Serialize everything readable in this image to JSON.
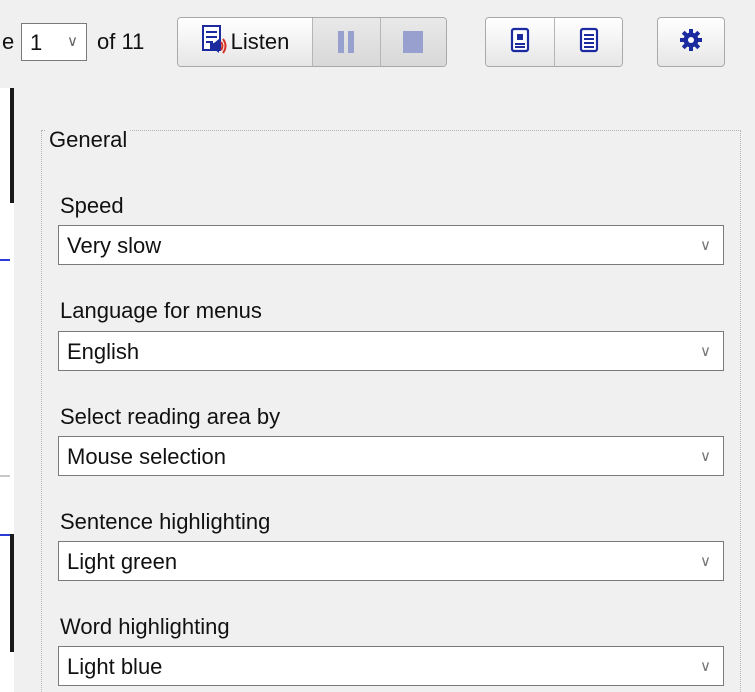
{
  "toolbar": {
    "page_prefix": "e",
    "page_value": "1",
    "page_of": "of 11",
    "listen_label": "Listen"
  },
  "icons": {
    "listen": "speaker-document-icon",
    "pause": "pause-icon",
    "stop": "stop-icon",
    "view1": "page-view-icon",
    "view2": "text-view-icon",
    "settings": "gear-icon",
    "chevron": "chevron-down-icon"
  },
  "chevron_glyph": "∨",
  "settings": {
    "group_label": "General",
    "fields": [
      {
        "label": "Speed",
        "value": "Very slow"
      },
      {
        "label": "Language for menus",
        "value": "English"
      },
      {
        "label": "Select reading area by",
        "value": "Mouse selection"
      },
      {
        "label": "Sentence highlighting",
        "value": "Light green"
      },
      {
        "label": "Word highlighting",
        "value": "Light blue"
      }
    ]
  },
  "colors": {
    "toolbar_bg": "#f0f0f0",
    "panel_bg": "#f0f0f0",
    "icon_blue": "#1b2a9e",
    "disabled_icon": "#97a0ce",
    "speaker_red": "#d93025"
  }
}
